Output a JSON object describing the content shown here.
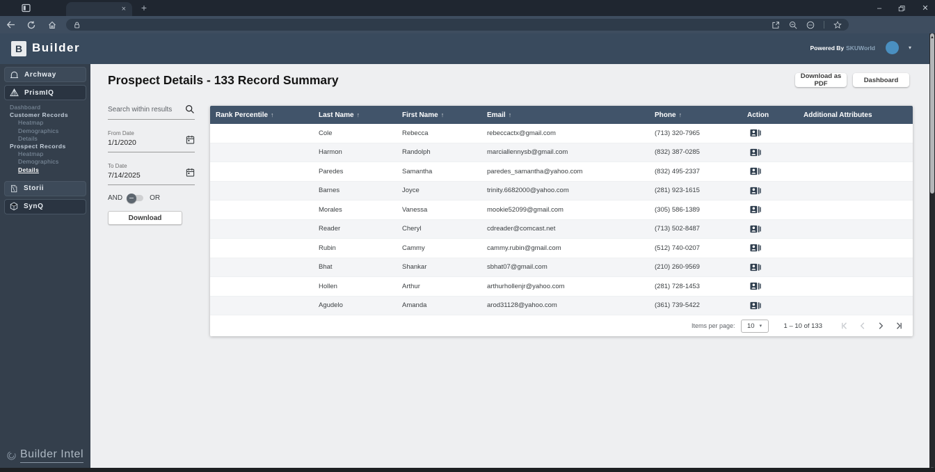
{
  "colors": {
    "accent_blue": "#4a8fc0",
    "header_bar": "#394a5d",
    "table_header": "#41546a",
    "sidebar": "#343f4c"
  },
  "icons": {
    "tab_close": "×",
    "new_tab": "+",
    "minimize": "–",
    "close_window": "✕",
    "caret_down": "▾",
    "logo_letter": "B"
  },
  "header": {
    "app_name": "Builder",
    "powered_by": "Powered By",
    "powered_by_brand": "SKUWorld"
  },
  "sidebar": {
    "items": [
      {
        "label": "Archway",
        "icon": "arch-icon",
        "dark": false
      },
      {
        "label": "PrismIQ",
        "icon": "prism-icon",
        "dark": true
      }
    ],
    "submenu": [
      {
        "label": "Dashboard"
      },
      {
        "label": "Customer Records",
        "group": true
      },
      {
        "label": "Heatmap",
        "indent": true
      },
      {
        "label": "Demographics",
        "indent": true
      },
      {
        "label": "Details",
        "indent": true
      },
      {
        "label": "Prospect Records",
        "group": true
      },
      {
        "label": "Heatmap",
        "indent": true
      },
      {
        "label": "Demographics",
        "indent": true
      },
      {
        "label": "Details",
        "indent": true,
        "active": true
      }
    ],
    "items_lower": [
      {
        "label": "Storii",
        "icon": "book-icon",
        "dark": false
      },
      {
        "label": "SynQ",
        "icon": "cube-icon",
        "dark": true
      }
    ],
    "footer_logo": "Builder Intel"
  },
  "page": {
    "title": "Prospect Details  - 133 Record Summary",
    "download_pdf_button": "Download as PDF",
    "dashboard_button": "Dashboard"
  },
  "filters": {
    "search_placeholder": "Search within results",
    "from_date": {
      "label": "From Date",
      "value": "1/1/2020"
    },
    "to_date": {
      "label": "To Date",
      "value": "7/14/2025"
    },
    "logic_left": "AND",
    "logic_right": "OR",
    "download_button": "Download"
  },
  "table": {
    "columns": [
      {
        "label": "Rank Percentile",
        "sort_icon": "↑"
      },
      {
        "label": "Last Name",
        "sort_icon": "↑"
      },
      {
        "label": "First Name",
        "sort_icon": "↑"
      },
      {
        "label": "Email",
        "sort_icon": "↑"
      },
      {
        "label": "Phone",
        "sort_icon": "↑"
      },
      {
        "label": "Action"
      },
      {
        "label": "Additional Attributes"
      }
    ],
    "rows": [
      {
        "rank": "",
        "last": "Cole",
        "first": "Rebecca",
        "email": "rebeccactx@gmail.com",
        "phone": "(713) 320-7965"
      },
      {
        "rank": "",
        "last": "Harmon",
        "first": "Randolph",
        "email": "marciallennysb@gmail.com",
        "phone": "(832) 387-0285"
      },
      {
        "rank": "",
        "last": "Paredes",
        "first": "Samantha",
        "email": "paredes_samantha@yahoo.com",
        "phone": "(832) 495-2337"
      },
      {
        "rank": "",
        "last": "Barnes",
        "first": "Joyce",
        "email": "trinity.6682000@yahoo.com",
        "phone": "(281) 923-1615"
      },
      {
        "rank": "",
        "last": "Morales",
        "first": "Vanessa",
        "email": "mookie52099@gmail.com",
        "phone": "(305) 586-1389"
      },
      {
        "rank": "",
        "last": "Reader",
        "first": "Cheryl",
        "email": "cdreader@comcast.net",
        "phone": "(713) 502-8487"
      },
      {
        "rank": "",
        "last": "Rubin",
        "first": "Cammy",
        "email": "cammy.rubin@gmail.com",
        "phone": "(512) 740-0207"
      },
      {
        "rank": "",
        "last": "Bhat",
        "first": "Shankar",
        "email": "sbhat07@gmail.com",
        "phone": "(210) 260-9569"
      },
      {
        "rank": "",
        "last": "Hollen",
        "first": "Arthur",
        "email": "arthurhollenjr@yahoo.com",
        "phone": "(281) 728-1453"
      },
      {
        "rank": "",
        "last": "Agudelo",
        "first": "Amanda",
        "email": "arod31128@yahoo.com",
        "phone": "(361) 739-5422"
      }
    ],
    "pagination": {
      "items_per_page_label": "Items per page:",
      "items_per_page_value": "10",
      "range": "1 – 10 of 133"
    }
  }
}
